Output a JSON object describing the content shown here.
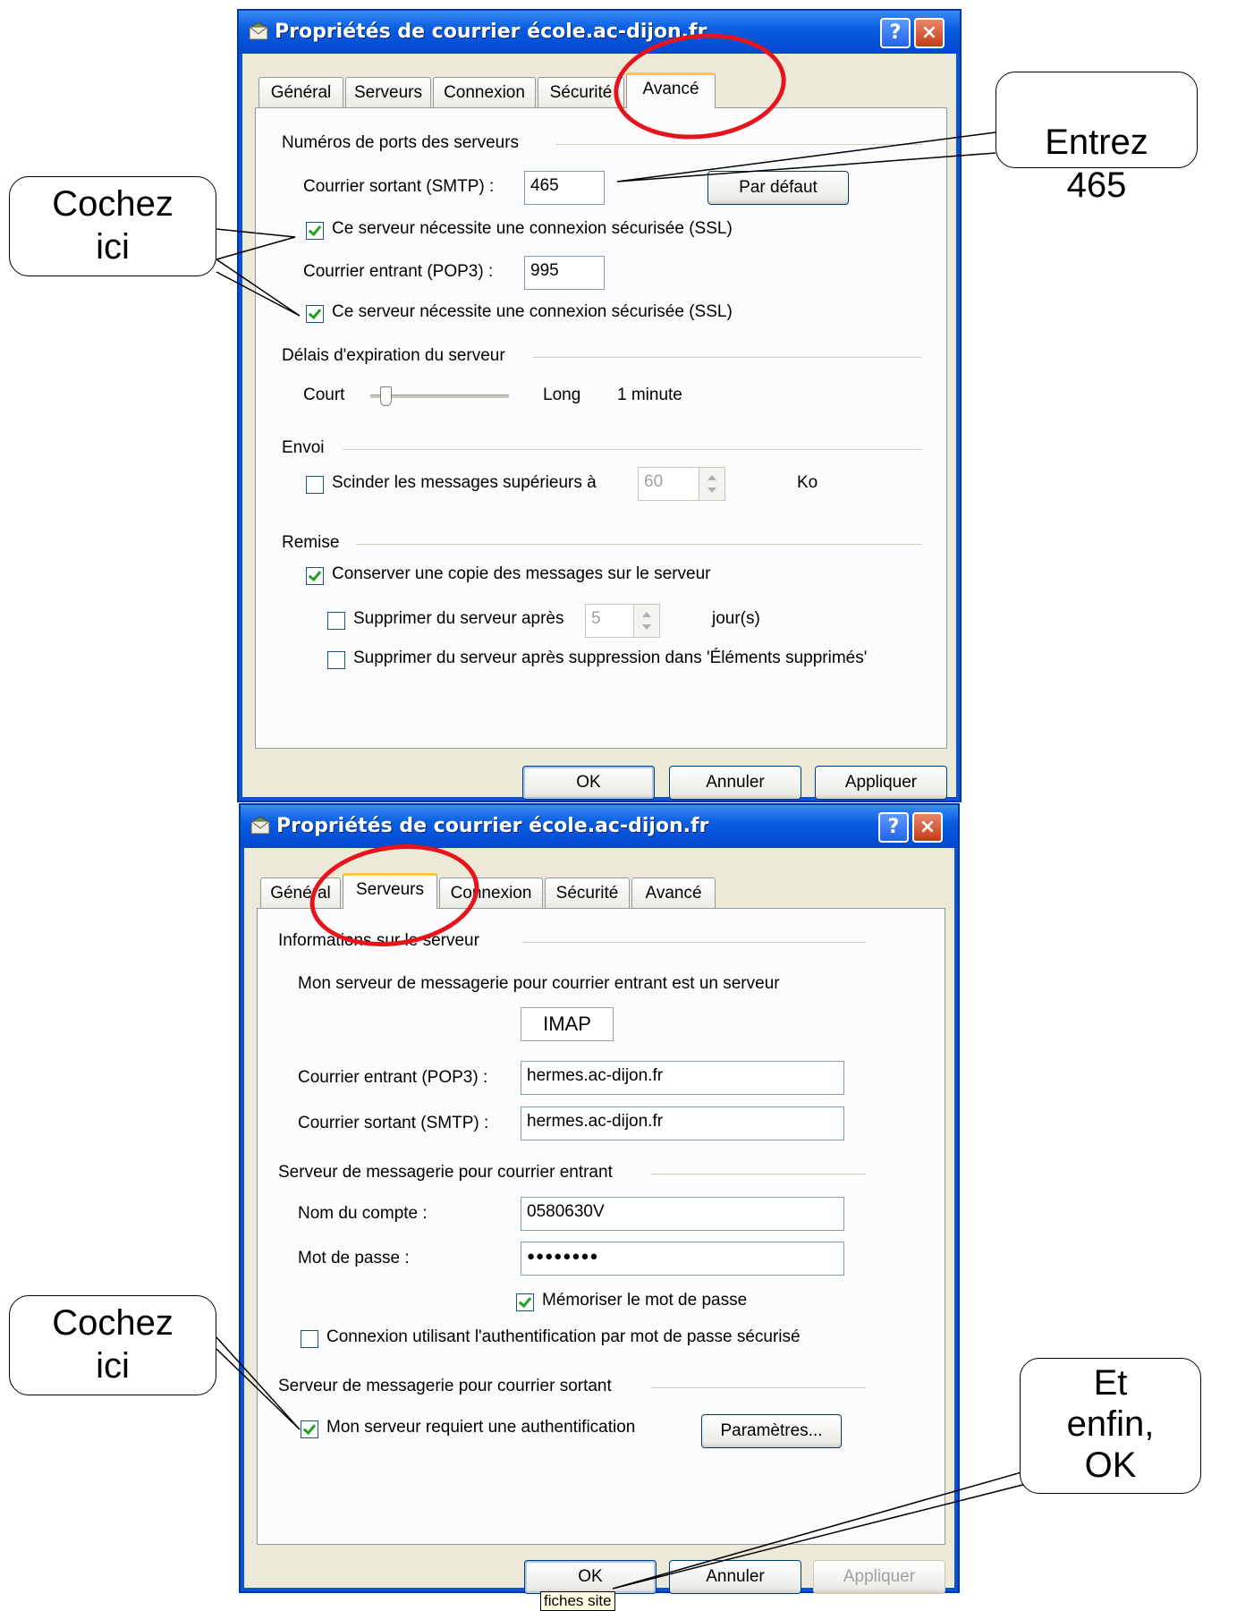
{
  "dialog1": {
    "title": "Propriétés de courrier école.ac-dijon.fr",
    "help_label": "?",
    "close_label": "×",
    "tabs": [
      "Général",
      "Serveurs",
      "Connexion",
      "Sécurité",
      "Avancé"
    ],
    "active_tab": "Avancé",
    "ports_group": "Numéros de ports des serveurs",
    "smtp_label": "Courrier sortant (SMTP) :",
    "smtp_port": "465",
    "default_button": "Par défaut",
    "ssl_label": "Ce serveur nécessite une connexion sécurisée (SSL)",
    "pop3_label": "Courrier entrant (POP3) :",
    "pop3_port": "995",
    "timeout_group": "Délais d'expiration du serveur",
    "timeout_short": "Court",
    "timeout_long": "Long",
    "timeout_value": "1 minute",
    "timeout_level": 0.1,
    "send_group": "Envoi",
    "split_label": "Scinder les messages supérieurs à",
    "split_value": "60",
    "split_unit": "Ko",
    "delivery_group": "Remise",
    "keep_copy_label": "Conserver une copie des messages sur le serveur",
    "delete_after_label": "Supprimer du serveur après",
    "delete_after_value": "5",
    "delete_after_unit": "jour(s)",
    "delete_deleted_label": "Supprimer du serveur après suppression dans 'Éléments supprimés'",
    "ok": "OK",
    "cancel": "Annuler",
    "apply": "Appliquer"
  },
  "dialog2": {
    "title": "Propriétés de courrier école.ac-dijon.fr",
    "help_label": "?",
    "close_label": "×",
    "tabs": [
      "Général",
      "Serveurs",
      "Connexion",
      "Sécurité",
      "Avancé"
    ],
    "active_tab": "Serveurs",
    "info_group": "Informations sur le serveur",
    "server_type_text": "Mon serveur de messagerie pour courrier entrant est un serveur",
    "server_type": "IMAP",
    "incoming_label": "Courrier entrant (POP3) :",
    "incoming_value": "hermes.ac-dijon.fr",
    "outgoing_label": "Courrier sortant (SMTP) :",
    "outgoing_value": "hermes.ac-dijon.fr",
    "incoming_group": "Serveur de messagerie pour courrier entrant",
    "account_label": "Nom du compte :",
    "account_value": "0580630V",
    "password_label": "Mot de passe :",
    "password_value": "●●●●●●●●",
    "remember_label": "Mémoriser le mot de passe",
    "spa_label": "Connexion utilisant l'authentification par mot de passe sécurisé",
    "outgoing_group": "Serveur de messagerie pour courrier sortant",
    "auth_label": "Mon serveur requiert une authentification",
    "settings_button": "Paramètres...",
    "ok": "OK",
    "cancel": "Annuler",
    "apply": "Appliquer",
    "tooltip": "fiches site"
  },
  "callouts": {
    "enter": "Entrez\n465",
    "check1": "Cochez\nici",
    "check2": "Cochez\nici",
    "finally": "Et\nenfin,\nOK"
  },
  "colors": {
    "titlebar": "#0a5ee0",
    "dialog_face": "#ece9d8",
    "highlight_ellipse": "#e8141c",
    "checkmark": "#21a121"
  }
}
